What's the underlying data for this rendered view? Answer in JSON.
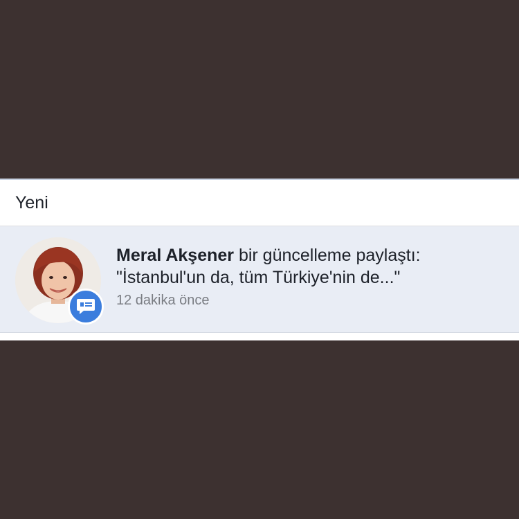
{
  "section": {
    "title": "Yeni"
  },
  "notification": {
    "actor": "Meral Akşener",
    "action": "bir güncelleme paylaştı:",
    "quote": "\"İstanbul'un da, tüm Türkiye'nin de...\"",
    "time": "12 dakika önce",
    "badge_icon": "comment-icon",
    "badge_color": "#3b7ddd",
    "highlight_color": "#e9edf5"
  },
  "colors": {
    "background": "#3d3130",
    "text": "#1d2129",
    "muted": "#7a7d83"
  }
}
